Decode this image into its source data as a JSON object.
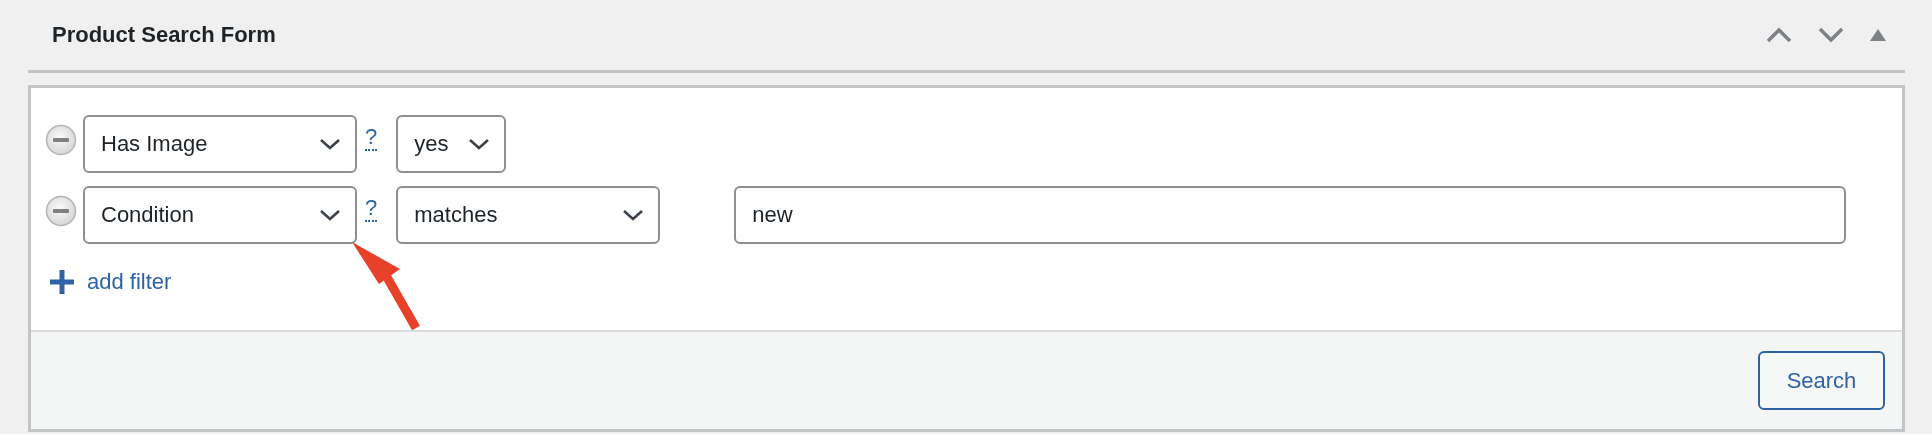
{
  "panel": {
    "title": "Product Search Form"
  },
  "filters": [
    {
      "field": "Has Image",
      "help": "?",
      "operator": "yes"
    },
    {
      "field": "Condition",
      "help": "?",
      "operator": "matches",
      "value": "new"
    }
  ],
  "add_filter": "add filter",
  "search_button": "Search"
}
